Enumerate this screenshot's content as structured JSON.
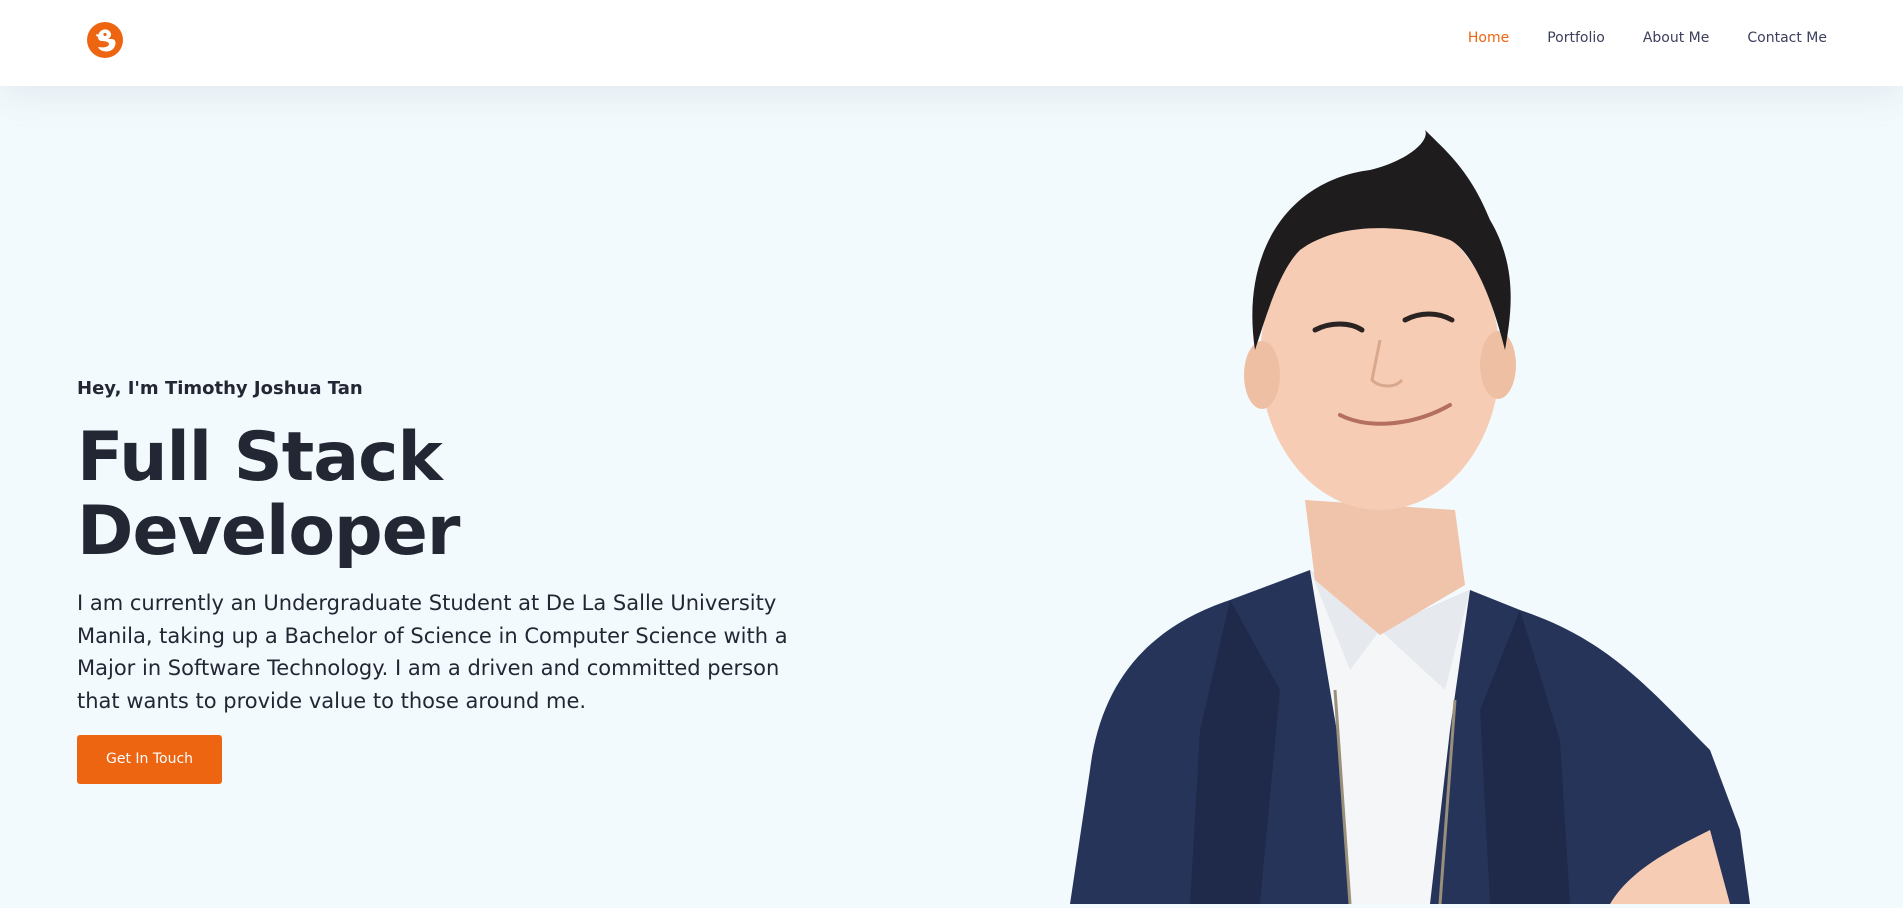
{
  "nav": {
    "items": [
      {
        "label": "Home",
        "active": true
      },
      {
        "label": "Portfolio",
        "active": false
      },
      {
        "label": "About Me",
        "active": false
      },
      {
        "label": "Contact Me",
        "active": false
      }
    ]
  },
  "hero": {
    "greeting": "Hey, I'm Timothy Joshua Tan",
    "title": "Full Stack Developer",
    "description": "I am currently an Undergraduate Student at De La Salle University Manila, taking up a Bachelor of Science in Computer Science with a Major in Software Technology. I am a driven and committed person that wants to provide value to those around me.",
    "cta_label": "Get In Touch"
  },
  "colors": {
    "accent": "#ee6511",
    "background": "#f3fafd",
    "text": "#232734",
    "nav_text": "#3b3f5c"
  },
  "icons": {
    "logo": "duck-logo-icon"
  }
}
